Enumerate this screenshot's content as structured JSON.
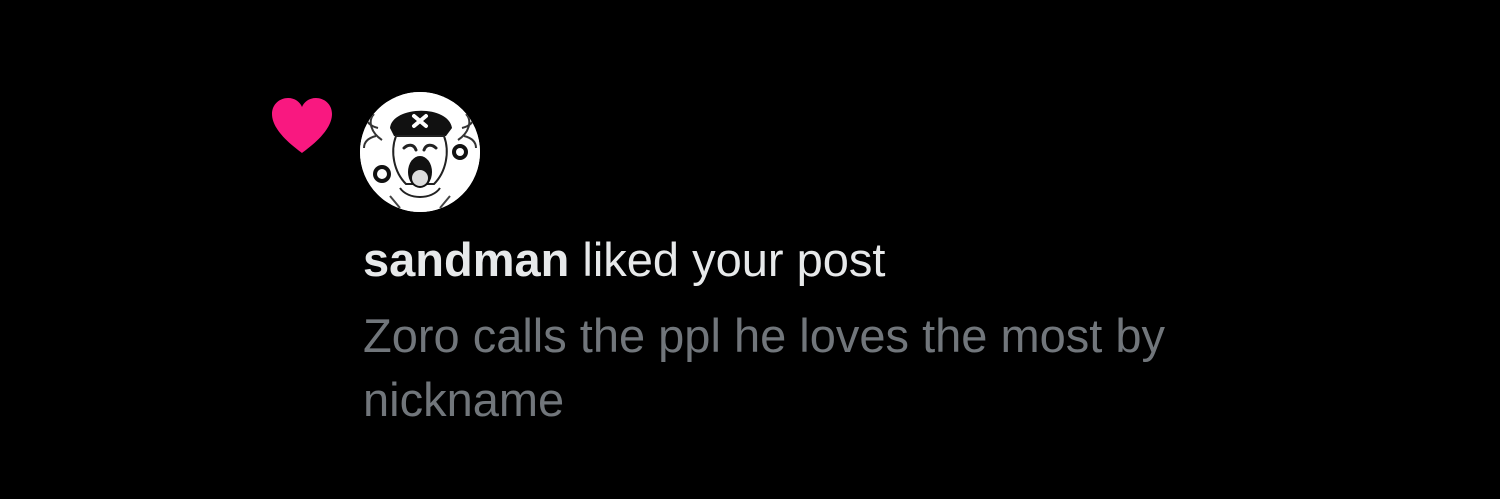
{
  "notification": {
    "type_icon": "heart-icon",
    "heart_color": "#f91880",
    "avatar_icon": "cartoon-avatar",
    "username": "sandman",
    "action_text": "liked your post",
    "post_text": "Zoro calls the ppl he loves the most by nickname"
  },
  "colors": {
    "background": "#000000",
    "primary_text": "#e7e9ea",
    "secondary_text": "#71767b",
    "like": "#f91880"
  }
}
